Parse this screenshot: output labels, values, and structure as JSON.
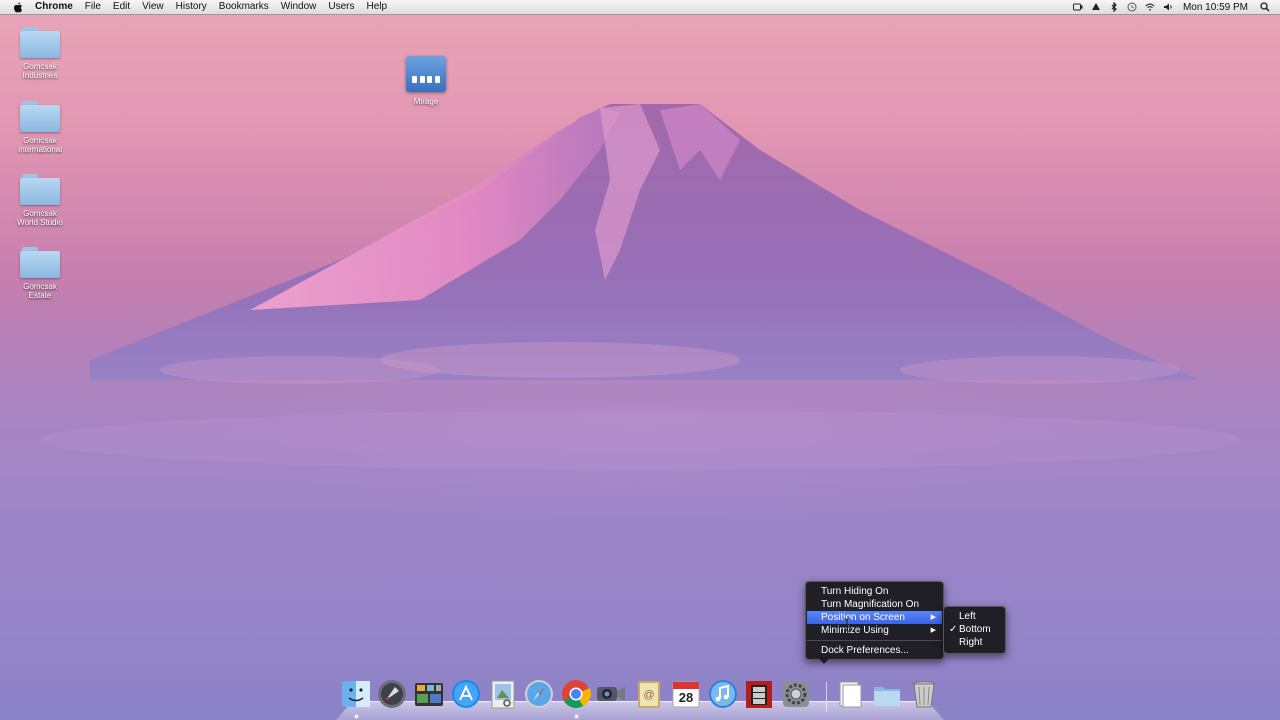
{
  "menubar": {
    "app_name": "Chrome",
    "menus": [
      "File",
      "Edit",
      "View",
      "History",
      "Bookmarks",
      "Window",
      "Users",
      "Help"
    ],
    "status_icons": [
      "camera-icon",
      "drive-icon",
      "bluetooth-icon",
      "time-machine-icon",
      "wifi-icon",
      "volume-icon"
    ],
    "clock": "Mon 10:59 PM"
  },
  "desktop_icons": [
    {
      "line1": "Gomcsak",
      "line2": "Industries",
      "icon": "folder-icon"
    },
    {
      "line1": "Gomcsak",
      "line2": "International",
      "icon": "folder-icon"
    },
    {
      "line1": "Gomcsak",
      "line2": "World Studio",
      "icon": "folder-icon"
    },
    {
      "line1": "Gomcsak",
      "line2": "Estate",
      "icon": "folder-icon"
    },
    {
      "line1": "Mirage",
      "line2": "",
      "icon": "drive-icon"
    }
  ],
  "dock": {
    "apps": [
      "finder-icon",
      "launchpad-icon",
      "mission-control-icon",
      "app-store-icon",
      "preview-icon",
      "safari-icon",
      "chrome-icon",
      "facetime-icon",
      "address-book-icon",
      "calendar-icon",
      "itunes-icon",
      "photo-booth-icon",
      "system-preferences-icon"
    ],
    "calendar_day": "28",
    "right": [
      "documents-stack-icon",
      "folder-stack-icon",
      "trash-icon"
    ]
  },
  "dock_menu": {
    "items": [
      "Turn Hiding On",
      "Turn Magnification On",
      "Position on Screen",
      "Minimize Using",
      "Dock Preferences..."
    ],
    "highlighted": "Position on Screen"
  },
  "position_submenu": {
    "items": [
      "Left",
      "Bottom",
      "Right"
    ],
    "checked": "Bottom",
    "check_mark": "✓"
  }
}
